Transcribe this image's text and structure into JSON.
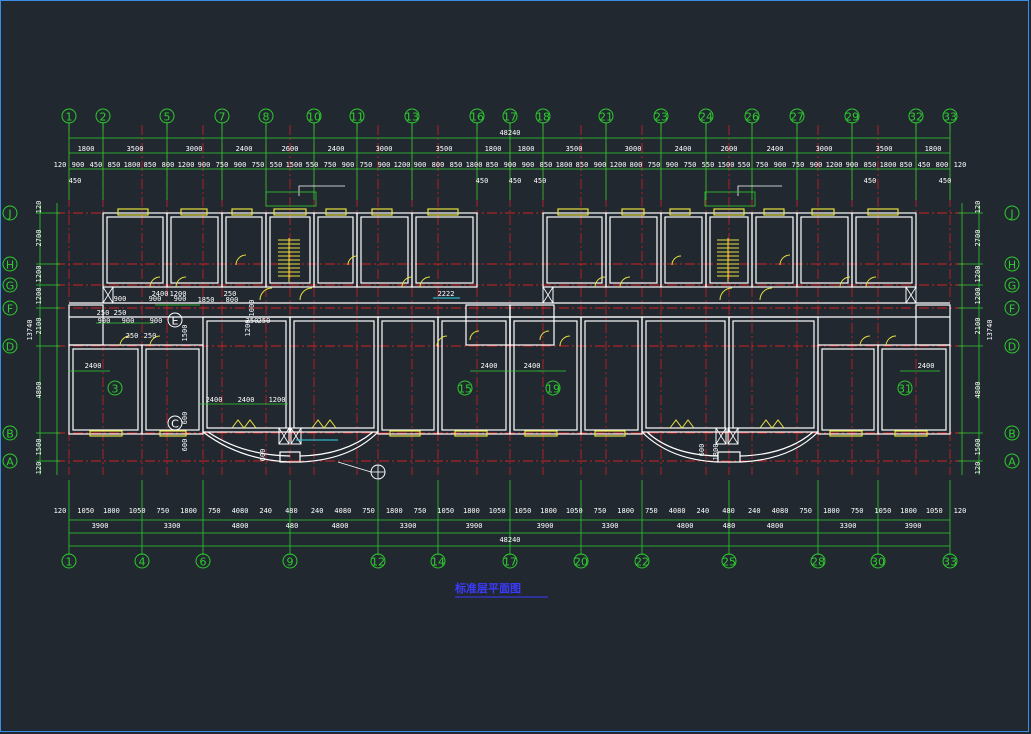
{
  "drawing_title": "标准层平面图",
  "colors": {
    "background": "#212830",
    "wall": "#ffffff",
    "grid_line": "#d02020",
    "dimension": "#2ecc2e",
    "window": "#e8e040",
    "door": "#e8e040",
    "title": "#3b3bff"
  },
  "axes_top": [
    "1",
    "2",
    "5",
    "7",
    "8",
    "10",
    "11",
    "13",
    "16",
    "17",
    "18",
    "21",
    "23",
    "24",
    "26",
    "27",
    "29",
    "32",
    "33"
  ],
  "axes_bottom": [
    "1",
    "4",
    "6",
    "9",
    "12",
    "14",
    "17",
    "20",
    "22",
    "25",
    "28",
    "30",
    "33"
  ],
  "axes_rows": [
    "J",
    "H",
    "G",
    "F",
    "D",
    "B",
    "A"
  ],
  "top_overall": "48240",
  "top_segments": [
    "1800",
    "3500",
    "3000",
    "2400",
    "2600",
    "2400",
    "3000",
    "3500",
    "1800",
    "1800",
    "3500",
    "3000",
    "2400",
    "2600",
    "2400",
    "3000",
    "3500",
    "1800"
  ],
  "top_detail": [
    "120",
    "900",
    "450",
    "850",
    "1800",
    "850",
    "800",
    "1200",
    "900",
    "750",
    "900",
    "750",
    "550",
    "1500",
    "550",
    "750",
    "900",
    "750",
    "900",
    "1200",
    "900",
    "800",
    "850",
    "1800",
    "850",
    "900",
    "900",
    "850",
    "1800",
    "850",
    "900",
    "1200",
    "800",
    "750",
    "900",
    "750",
    "550",
    "1500",
    "550",
    "750",
    "900",
    "750",
    "900",
    "1200",
    "900",
    "850",
    "1800",
    "850",
    "450",
    "800",
    "120"
  ],
  "top_small": [
    "450",
    "450",
    "450",
    "450",
    "450",
    "450"
  ],
  "bottom_detail": [
    "120",
    "1050",
    "1800",
    "1050",
    "750",
    "1800",
    "750",
    "4080",
    "240",
    "480",
    "240",
    "4080",
    "750",
    "1800",
    "750",
    "1050",
    "1800",
    "1050",
    "1050",
    "1800",
    "1050",
    "750",
    "1800",
    "750",
    "4080",
    "240",
    "480",
    "240",
    "4080",
    "750",
    "1800",
    "750",
    "1050",
    "1800",
    "1050",
    "120"
  ],
  "bottom_mid": [
    "3900",
    "3300",
    "4800",
    "480",
    "4800",
    "3300",
    "3900",
    "3900",
    "3300",
    "4800",
    "480",
    "4800",
    "3300",
    "3900"
  ],
  "bottom_overall": "48240",
  "left_dims": [
    "120",
    "2700",
    "1200",
    "1200",
    "2100",
    "4800",
    "1500",
    "120"
  ],
  "left_total": "13740",
  "right_dims": [
    "120",
    "2700",
    "1200",
    "1200",
    "2100",
    "4800",
    "1500",
    "120"
  ],
  "right_total": "13740",
  "inner_dims": [
    "2400",
    "2400",
    "2400",
    "2400",
    "2400",
    "2400",
    "1200",
    "2400",
    "1200",
    "250",
    "250",
    "250",
    "250",
    "900",
    "900",
    "900",
    "1850",
    "800",
    "250",
    "900",
    "900",
    "900",
    "250",
    "250",
    "1000",
    "1200",
    "1500",
    "600",
    "600",
    "600",
    "600",
    "1800",
    "2222"
  ],
  "room_tags": [
    "3",
    "15",
    "19",
    "31"
  ],
  "marker_tags": [
    "E",
    "C"
  ]
}
